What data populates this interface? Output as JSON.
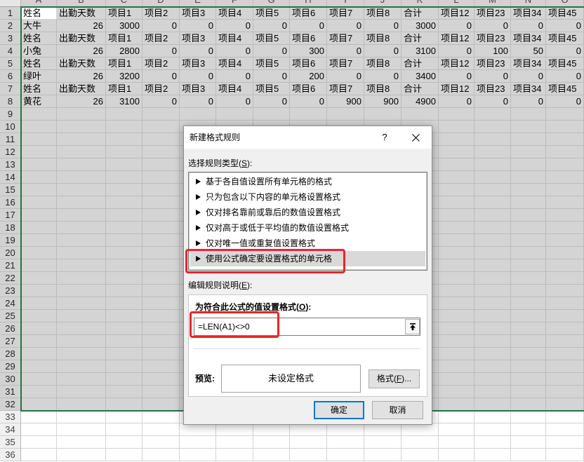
{
  "sheet": {
    "columns": [
      "A",
      "B",
      "C",
      "D",
      "E",
      "F",
      "G",
      "H",
      "I",
      "J",
      "K",
      "L",
      "M",
      "N",
      "O"
    ],
    "row_numbers": [
      "1",
      "2",
      "3",
      "4",
      "5",
      "6",
      "7",
      "8",
      "9",
      "10",
      "11",
      "12",
      "13",
      "14",
      "15",
      "16",
      "17",
      "18",
      "19",
      "20",
      "21",
      "22",
      "23",
      "24",
      "25",
      "26",
      "27",
      "28",
      "29",
      "30",
      "31",
      "32",
      "33",
      "34",
      "35",
      "36"
    ],
    "rows": [
      [
        "姓名",
        "出勤天数",
        "项目1",
        "项目2",
        "项目3",
        "项目4",
        "项目5",
        "项目6",
        "项目7",
        "项目8",
        "合计",
        "项目12",
        "项目23",
        "项目34",
        "项目45"
      ],
      [
        "大牛",
        "26",
        "3000",
        "0",
        "0",
        "0",
        "0",
        "0",
        "0",
        "0",
        "3000",
        "0",
        "0",
        "0",
        "0"
      ],
      [
        "姓名",
        "出勤天数",
        "项目1",
        "项目2",
        "项目3",
        "项目4",
        "项目5",
        "项目6",
        "项目7",
        "项目8",
        "合计",
        "项目12",
        "项目23",
        "项目34",
        "项目45"
      ],
      [
        "小兔",
        "26",
        "2800",
        "0",
        "0",
        "0",
        "0",
        "300",
        "0",
        "0",
        "3100",
        "0",
        "100",
        "50",
        "0"
      ],
      [
        "姓名",
        "出勤天数",
        "项目1",
        "项目2",
        "项目3",
        "项目4",
        "项目5",
        "项目6",
        "项目7",
        "项目8",
        "合计",
        "项目12",
        "项目23",
        "项目34",
        "项目45"
      ],
      [
        "绿叶",
        "26",
        "3200",
        "0",
        "0",
        "0",
        "0",
        "200",
        "0",
        "0",
        "3400",
        "0",
        "0",
        "0",
        "0"
      ],
      [
        "姓名",
        "出勤天数",
        "项目1",
        "项目2",
        "项目3",
        "项目4",
        "项目5",
        "项目6",
        "项目7",
        "项目8",
        "合计",
        "项目12",
        "项目23",
        "项目34",
        "项目45"
      ],
      [
        "黄花",
        "26",
        "3100",
        "0",
        "0",
        "0",
        "0",
        "0",
        "900",
        "900",
        "4900",
        "0",
        "0",
        "0",
        "0"
      ]
    ]
  },
  "dialog": {
    "title": "新建格式规则",
    "help_label": "?",
    "rule_type_label": {
      "text": "选择规则类型(S):",
      "access_key": "S"
    },
    "rule_types": [
      "基于各自值设置所有单元格的格式",
      "只为包含以下内容的单元格设置格式",
      "仅对排名靠前或靠后的数值设置格式",
      "仅对高于或低于平均值的数值设置格式",
      "仅对唯一值或重复值设置格式",
      "使用公式确定要设置格式的单元格"
    ],
    "selected_rule_index": 5,
    "edit_label": {
      "text": "编辑规则说明(E):",
      "access_key": "E"
    },
    "formula_label": {
      "text": "为符合此公式的值设置格式(O):",
      "access_key": "O"
    },
    "formula_value": "=LEN(A1)<>0",
    "preview_label": "预览:",
    "preview_text": "未设定格式",
    "format_button": {
      "text": "格式(F)...",
      "access_key": "F"
    },
    "ok_button": "确定",
    "cancel_button": "取消"
  },
  "icons": {
    "close": "close-icon",
    "rule_marker": "triangle-right-icon",
    "collapse": "collapse-dialog-icon"
  },
  "colors": {
    "accent_green": "#217346",
    "selection_fill": "#d4d4d4",
    "highlight_red": "#e8262b",
    "default_button_border": "#0078d7"
  }
}
